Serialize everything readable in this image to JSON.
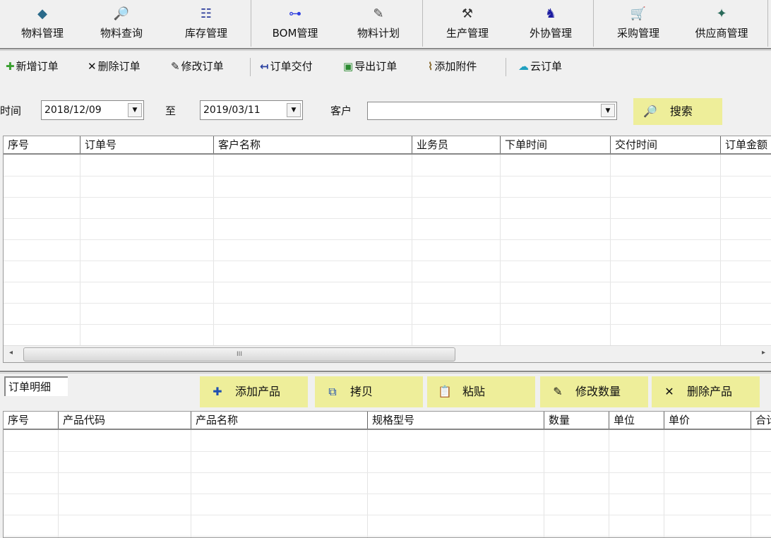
{
  "main_toolbar": [
    {
      "label": "物料管理",
      "icon": "material-manage-icon",
      "glyph": "◆",
      "color": "#2a6a8a"
    },
    {
      "label": "物料查询",
      "icon": "material-search-icon",
      "glyph": "🔎",
      "color": "#e06020"
    },
    {
      "label": "库存管理",
      "icon": "inventory-list-icon",
      "glyph": "☷",
      "color": "#2a3a9a"
    },
    {
      "label": "BOM管理",
      "icon": "bom-tree-icon",
      "glyph": "⊶",
      "color": "#3040e0"
    },
    {
      "label": "物料计划",
      "icon": "material-plan-icon",
      "glyph": "✎",
      "color": "#444"
    },
    {
      "label": "生产管理",
      "icon": "hammer-icon",
      "glyph": "⚒",
      "color": "#333"
    },
    {
      "label": "外协管理",
      "icon": "outsource-person-icon",
      "glyph": "♞",
      "color": "#1a1aa0"
    },
    {
      "label": "采购管理",
      "icon": "cart-icon",
      "glyph": "🛒",
      "color": "#c0a000"
    },
    {
      "label": "供应商管理",
      "icon": "supplier-icon",
      "glyph": "✦",
      "color": "#2a6a5a"
    }
  ],
  "order_toolbar": [
    {
      "label": "新增订单",
      "icon": "plus-icon",
      "glyph": "✚",
      "color": "#3aa030"
    },
    {
      "label": "删除订单",
      "icon": "close-icon",
      "glyph": "✕",
      "color": "#111"
    },
    {
      "label": "修改订单",
      "icon": "pencil-icon",
      "glyph": "✎",
      "color": "#222"
    },
    {
      "label": "订单交付",
      "icon": "deliver-icon",
      "glyph": "↤",
      "color": "#2a40a0"
    },
    {
      "label": "导出订单",
      "icon": "excel-icon",
      "glyph": "▣",
      "color": "#2a8a30"
    },
    {
      "label": "添加附件",
      "icon": "paperclip-icon",
      "glyph": "⌇",
      "color": "#806020"
    },
    {
      "label": "云订单",
      "icon": "cloud-icon",
      "glyph": "☁",
      "color": "#20a0c0"
    }
  ],
  "filter": {
    "time_label": "时间",
    "start_date": "2018/12/09",
    "to_label": "至",
    "end_date": "2019/03/11",
    "customer_label": "客户",
    "customer_value": "",
    "search_label": "搜索"
  },
  "orders_table": {
    "columns": [
      "序号",
      "订单号",
      "客户名称",
      "业务员",
      "下单时间",
      "交付时间",
      "订单金额"
    ],
    "rows": []
  },
  "detail": {
    "tab_label": "订单明细",
    "buttons": [
      {
        "label": "添加产品",
        "icon": "plus-icon",
        "glyph": "✚",
        "color": "#2050b0"
      },
      {
        "label": "拷贝",
        "icon": "copy-icon",
        "glyph": "⧉",
        "color": "#2050b0"
      },
      {
        "label": "粘贴",
        "icon": "paste-icon",
        "glyph": "📋",
        "color": "#2050b0"
      },
      {
        "label": "修改数量",
        "icon": "pencil-icon",
        "glyph": "✎",
        "color": "#111"
      },
      {
        "label": "删除产品",
        "icon": "close-icon",
        "glyph": "✕",
        "color": "#111"
      }
    ]
  },
  "detail_table": {
    "columns": [
      "序号",
      "产品代码",
      "产品名称",
      "规格型号",
      "数量",
      "单位",
      "单价",
      "合计"
    ],
    "rows": []
  },
  "colors": {
    "button_bg": "#eeee9a"
  }
}
